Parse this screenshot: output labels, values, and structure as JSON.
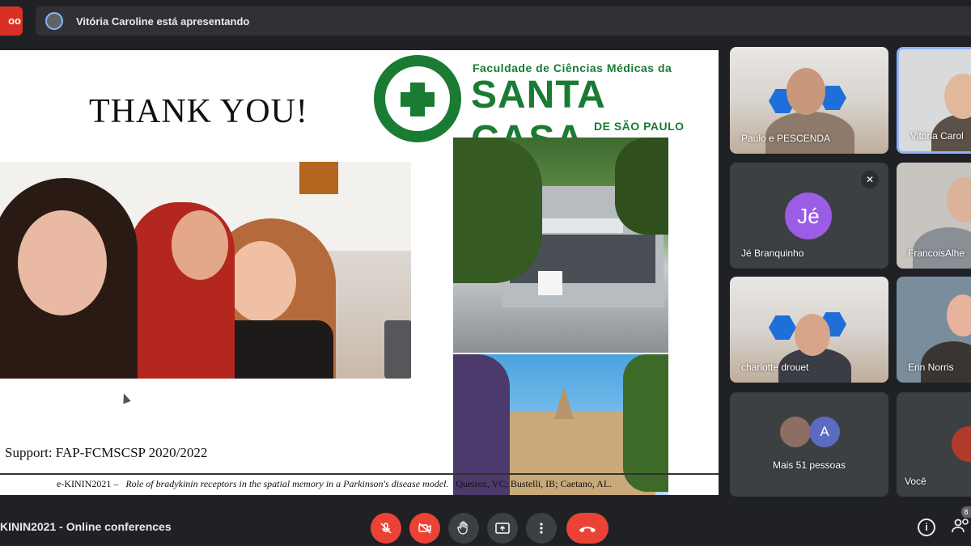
{
  "top_bar": {
    "rec_label": "oo",
    "presenting_text": "Vitória Caroline está apresentando"
  },
  "slide": {
    "title": "THANK YOU!",
    "logo": {
      "line1": "Faculdade de Ciências Médicas da",
      "line2": "SANTA CASA",
      "line3": "DE SÃO PAULO"
    },
    "support": "Support: FAP-FCMSCSP 2020/2022",
    "footer_event": "e-KININ2021 –",
    "footer_title": "Role of bradykinin receptors in the spatial memory in a Parkinson's disease model.",
    "footer_authors": "Queiroz, VC; Bustelli, IB; Caetano, AL."
  },
  "participants": [
    {
      "name": "Paulo e PESCENDA"
    },
    {
      "name": "Vitória Carol"
    },
    {
      "name": "Jé Branquinho",
      "initials": "Jé"
    },
    {
      "name": "FrancoisAlhe"
    },
    {
      "name": "charlotte drouet"
    },
    {
      "name": "Erin Norris"
    },
    {
      "name": "Mais 51 pessoas",
      "initial": "A"
    },
    {
      "name": "Você"
    }
  ],
  "bottom_bar": {
    "meeting_name": "KININ2021 - Online conferences",
    "people_count": "8"
  },
  "icons": {
    "mic": "mic-off-icon",
    "camera": "camera-off-icon",
    "hand": "raise-hand-icon",
    "present": "present-screen-icon",
    "more": "more-options-icon",
    "end": "end-call-icon",
    "info": "info-icon",
    "people": "people-icon"
  },
  "colors": {
    "accent": "#8ab4f8",
    "danger": "#ea4335",
    "brand_green": "#1a7b32",
    "avatar_purple": "#9b5ce6"
  }
}
